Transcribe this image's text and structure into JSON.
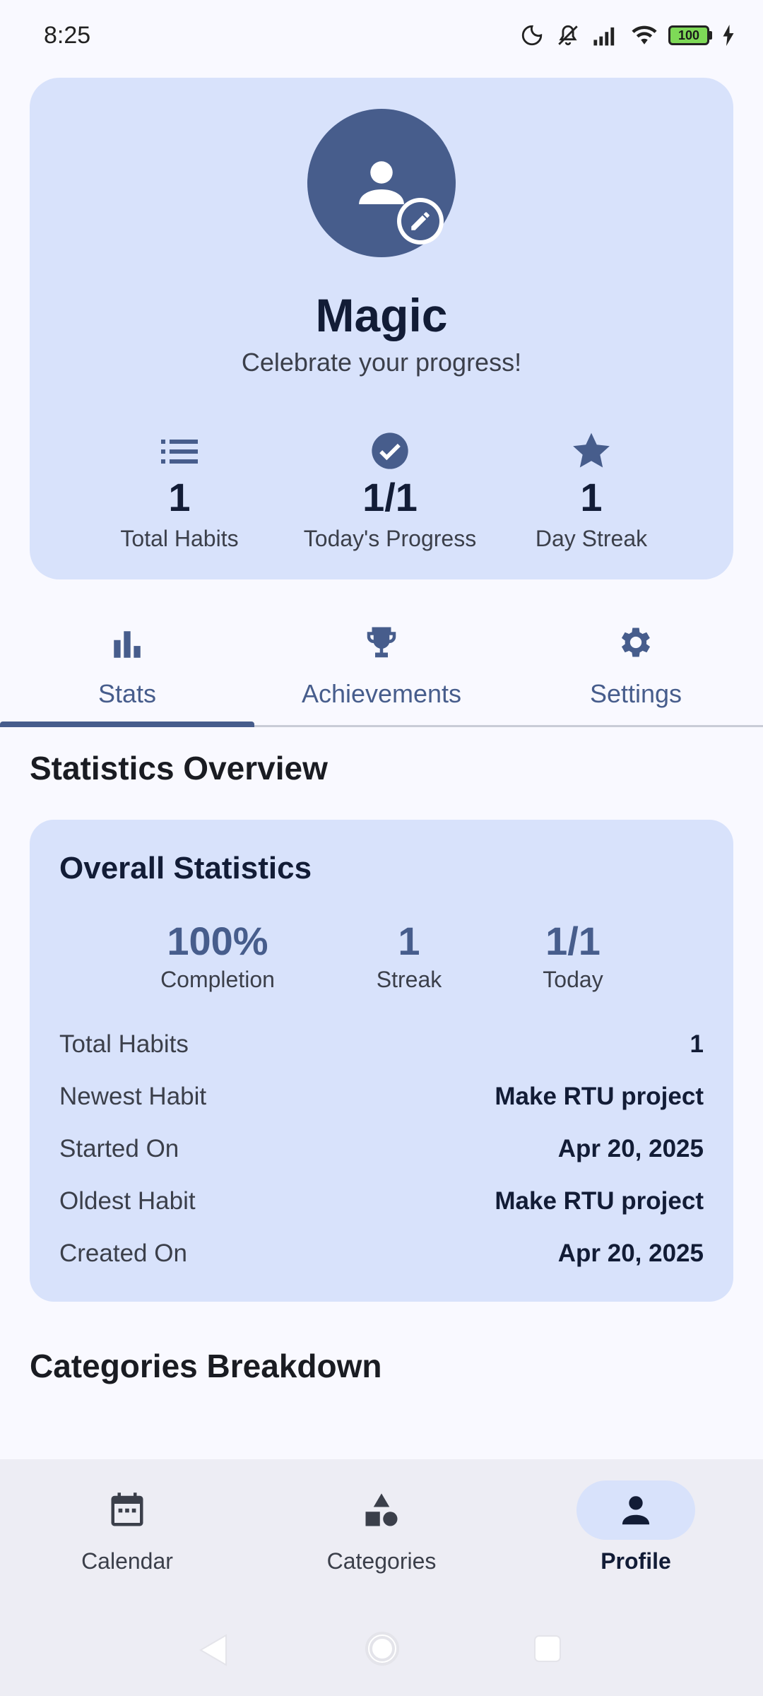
{
  "status_bar": {
    "time": "8:25",
    "battery": "100",
    "icons": [
      "moon-icon",
      "mute-icon",
      "signal-icon",
      "wifi-icon",
      "battery-icon",
      "charging-icon"
    ]
  },
  "profile": {
    "name": "Magic",
    "subtitle": "Celebrate your progress!",
    "avatar_icon": "person-icon",
    "edit_icon": "pencil-icon",
    "stats": [
      {
        "icon": "list-icon",
        "value": "1",
        "label": "Total Habits"
      },
      {
        "icon": "check-circle-icon",
        "value": "1/1",
        "label": "Today's Progress"
      },
      {
        "icon": "star-icon",
        "value": "1",
        "label": "Day Streak"
      }
    ]
  },
  "tabs": [
    {
      "icon": "bar-chart-icon",
      "label": "Stats",
      "active": true
    },
    {
      "icon": "trophy-icon",
      "label": "Achievements",
      "active": false
    },
    {
      "icon": "gear-icon",
      "label": "Settings",
      "active": false
    }
  ],
  "stats_section": {
    "title": "Statistics Overview",
    "card_title": "Overall Statistics",
    "summary": [
      {
        "value": "100%",
        "label": "Completion"
      },
      {
        "value": "1",
        "label": "Streak"
      },
      {
        "value": "1/1",
        "label": "Today"
      }
    ],
    "details": [
      {
        "key": "Total Habits",
        "value": "1"
      },
      {
        "key": "Newest Habit",
        "value": "Make RTU project"
      },
      {
        "key": "Started On",
        "value": "Apr 20, 2025"
      },
      {
        "key": "Oldest Habit",
        "value": "Make RTU project"
      },
      {
        "key": "Created On",
        "value": "Apr 20, 2025"
      }
    ]
  },
  "categories_section": {
    "title": "Categories Breakdown"
  },
  "bottom_nav": [
    {
      "icon": "calendar-icon",
      "label": "Calendar",
      "active": false
    },
    {
      "icon": "shapes-icon",
      "label": "Categories",
      "active": false
    },
    {
      "icon": "person-icon",
      "label": "Profile",
      "active": true
    }
  ],
  "colors": {
    "background": "#f9f9ff",
    "card": "#d8e2fb",
    "accent": "#475d8c",
    "text_dark": "#121c36",
    "nav_bg": "#ededf4"
  }
}
